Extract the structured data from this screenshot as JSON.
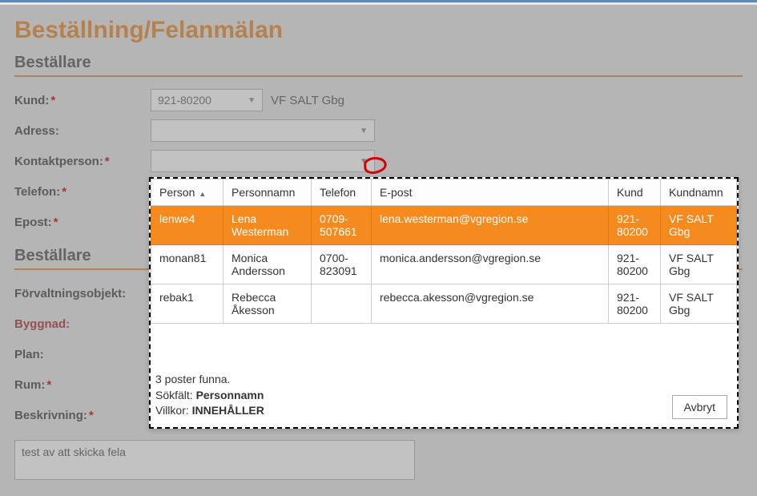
{
  "title": "Beställning/Felanmälan",
  "section1": {
    "title": "Beställare",
    "kund_label": "Kund:",
    "kund_value": "921-80200",
    "kund_name": "VF SALT Gbg",
    "adress_label": "Adress:",
    "kontakt_label": "Kontaktperson:",
    "telefon_label": "Telefon:",
    "epost_label": "Epost:"
  },
  "section2": {
    "title": "Beställare",
    "forvalt_label": "Förvaltningsobjekt:",
    "byggnad_label": "Byggnad:",
    "plan_label": "Plan:",
    "rum_label": "Rum:",
    "beskriv_label": "Beskrivning:",
    "beskriv_value": "test av att skicka fela"
  },
  "popup": {
    "headers": {
      "person": "Person",
      "personnamn": "Personnamn",
      "telefon": "Telefon",
      "epost": "E-post",
      "kund": "Kund",
      "kundnamn": "Kundnamn"
    },
    "rows": [
      {
        "person": "lenwe4",
        "namn": "Lena Westerman",
        "tel": "0709-507661",
        "epost": "lena.westerman@vgregion.se",
        "kund": "921-80200",
        "kundnamn": "VF SALT Gbg"
      },
      {
        "person": "monan81",
        "namn": "Monica Andersson",
        "tel": "0700-823091",
        "epost": "monica.andersson@vgregion.se",
        "kund": "921-80200",
        "kundnamn": "VF SALT Gbg"
      },
      {
        "person": "rebak1",
        "namn": "Rebecca Åkesson",
        "tel": "",
        "epost": "rebecca.akesson@vgregion.se",
        "kund": "921-80200",
        "kundnamn": "VF SALT Gbg"
      }
    ],
    "footer": {
      "count_text": "3 poster funna.",
      "sokfalt_label": "Sökfält: ",
      "sokfalt_value": "Personnamn",
      "villkor_label": "Villkor: ",
      "villkor_value": "INNEHÅLLER",
      "cancel": "Avbryt"
    }
  }
}
